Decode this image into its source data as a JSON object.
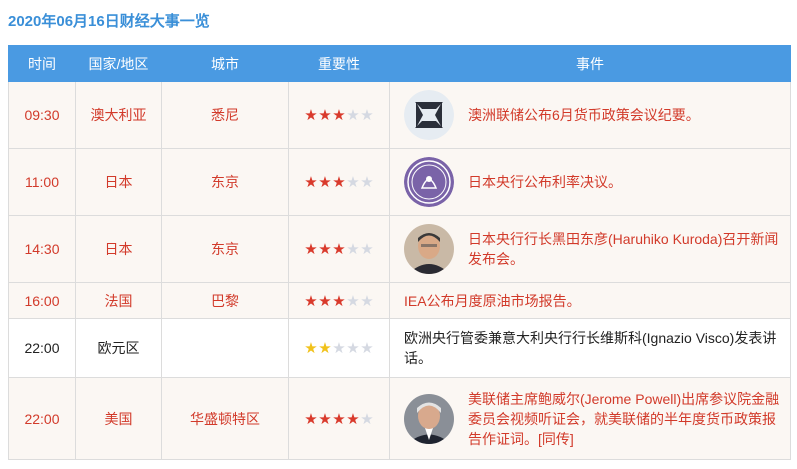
{
  "title": "2020年06月16日财经大事一览",
  "headers": {
    "time": "时间",
    "region": "国家/地区",
    "city": "城市",
    "importance": "重要性",
    "event": "事件"
  },
  "colors": {
    "header_bg": "#4a9ae2",
    "highlight_text": "#d23a2a",
    "star_red": "#d93a2c",
    "star_gold": "#f1c21b",
    "star_off": "#d5d9e2"
  },
  "rows": [
    {
      "time": "09:30",
      "region": "澳大利亚",
      "city": "悉尼",
      "stars": 3,
      "max_stars": 5,
      "event": "澳洲联储公布6月货币政策会议纪要。",
      "icon": "rba-logo-icon",
      "highlight": true
    },
    {
      "time": "11:00",
      "region": "日本",
      "city": "东京",
      "stars": 3,
      "max_stars": 5,
      "event": "日本央行公布利率决议。",
      "icon": "boj-seal-icon",
      "highlight": true
    },
    {
      "time": "14:30",
      "region": "日本",
      "city": "东京",
      "stars": 3,
      "max_stars": 5,
      "event": "日本央行行长黑田东彦(Haruhiko Kuroda)召开新闻发布会。",
      "icon": "kuroda-portrait-icon",
      "highlight": true
    },
    {
      "time": "16:00",
      "region": "法国",
      "city": "巴黎",
      "stars": 3,
      "max_stars": 5,
      "event": "IEA公布月度原油市场报告。",
      "icon": "",
      "highlight": true
    },
    {
      "time": "22:00",
      "region": "欧元区",
      "city": "",
      "stars": 2,
      "max_stars": 5,
      "event": "欧洲央行管委兼意大利央行行长维斯科(Ignazio Visco)发表讲话。",
      "icon": "",
      "highlight": false
    },
    {
      "time": "22:00",
      "region": "美国",
      "city": "华盛顿特区",
      "stars": 4,
      "max_stars": 5,
      "event": "美联储主席鲍威尔(Jerome Powell)出席参议院金融委员会视频听证会，就美联储的半年度货币政策报告作证词。[同传]",
      "icon": "powell-portrait-icon",
      "highlight": true
    }
  ]
}
